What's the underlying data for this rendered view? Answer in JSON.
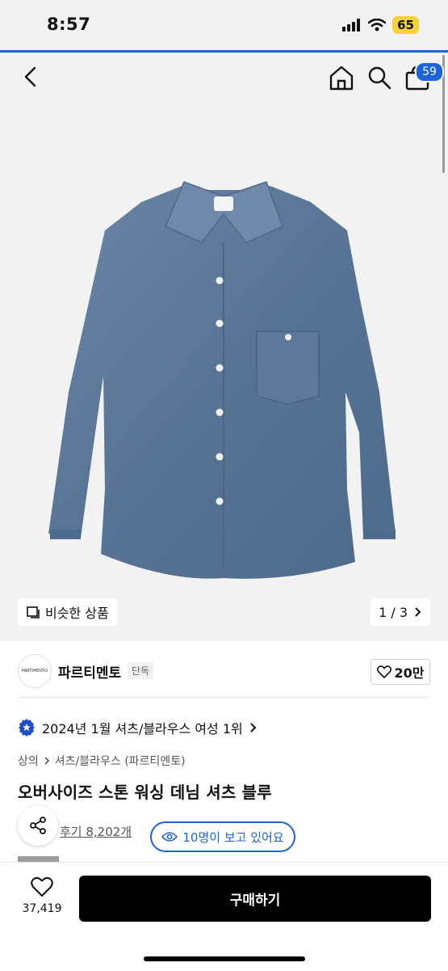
{
  "status": {
    "time": "8:57",
    "battery": "65"
  },
  "nav": {
    "cart_count": "59"
  },
  "gallery": {
    "similar_label": "비슷한 상품",
    "page_indicator": "1 / 3"
  },
  "brand": {
    "logo_text": "PARTIMENTO",
    "name": "파르티멘토",
    "exclusive_badge": "단독",
    "likes": "20만"
  },
  "ranking": {
    "text": "2024년 1월 셔츠/블라우스 여성 1위"
  },
  "breadcrumb": [
    "상의",
    "셔츠/블라우스 (파르티멘토)"
  ],
  "product": {
    "title": "오버사이즈 스톤 워싱 데님 셔츠 블루"
  },
  "review": {
    "label": "후기 8,202개"
  },
  "viewers": {
    "label": "10명이 보고 있어요"
  },
  "bottom": {
    "wish_count": "37,419",
    "buy_label": "구매하기"
  },
  "colors": {
    "accent": "#1d63d8",
    "buy_button": "#000000",
    "denim": "#5a7696"
  },
  "icons": [
    "back-icon",
    "home-icon",
    "search-icon",
    "bag-icon",
    "similar-icon",
    "chevron-right-icon",
    "heart-icon",
    "rank-badge-icon",
    "share-icon",
    "eye-icon"
  ]
}
